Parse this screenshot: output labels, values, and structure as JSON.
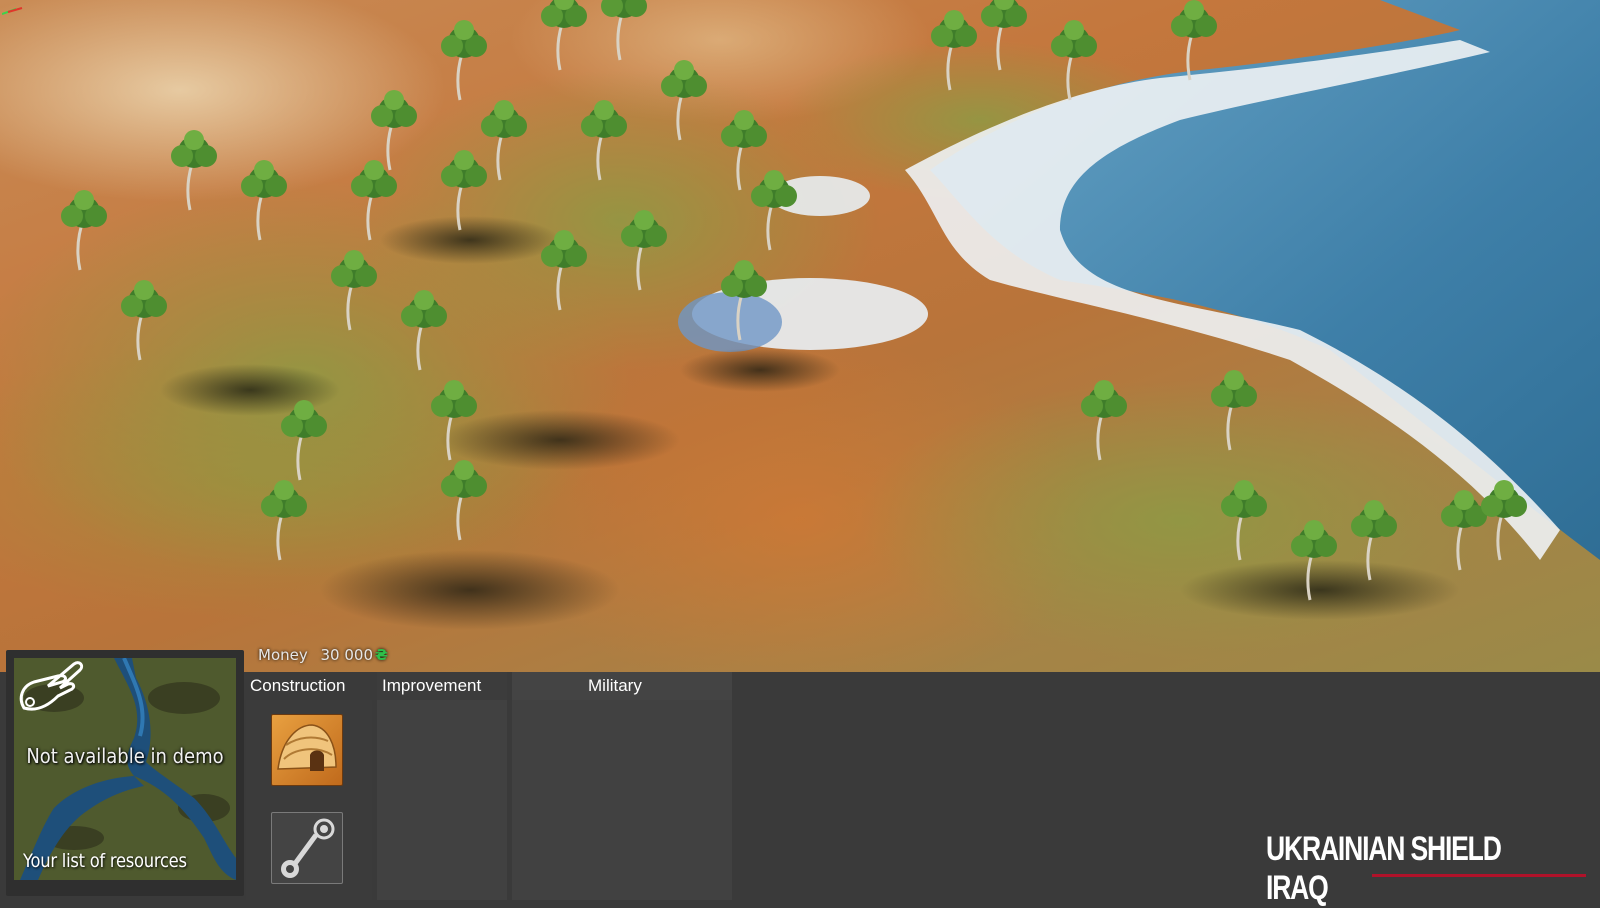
{
  "hud": {
    "money_label": "Money",
    "money_amount": "30 000",
    "money_currency_symbol": "₴",
    "currency_color": "#2ec04a"
  },
  "tabs": [
    {
      "label": "Construction"
    },
    {
      "label": "Improvement"
    },
    {
      "label": "Military"
    }
  ],
  "construction_items": [
    {
      "icon": "hut-icon"
    },
    {
      "icon": "steam-icon"
    }
  ],
  "minimap": {
    "notice": "Not available in demo",
    "resources_label": "Your list of resources",
    "hand_icon": "pointing-hand-icon"
  },
  "watermark": {
    "text": "UKRAINIAN SHIELD IRAQ",
    "underline_color": "#b0122a"
  }
}
